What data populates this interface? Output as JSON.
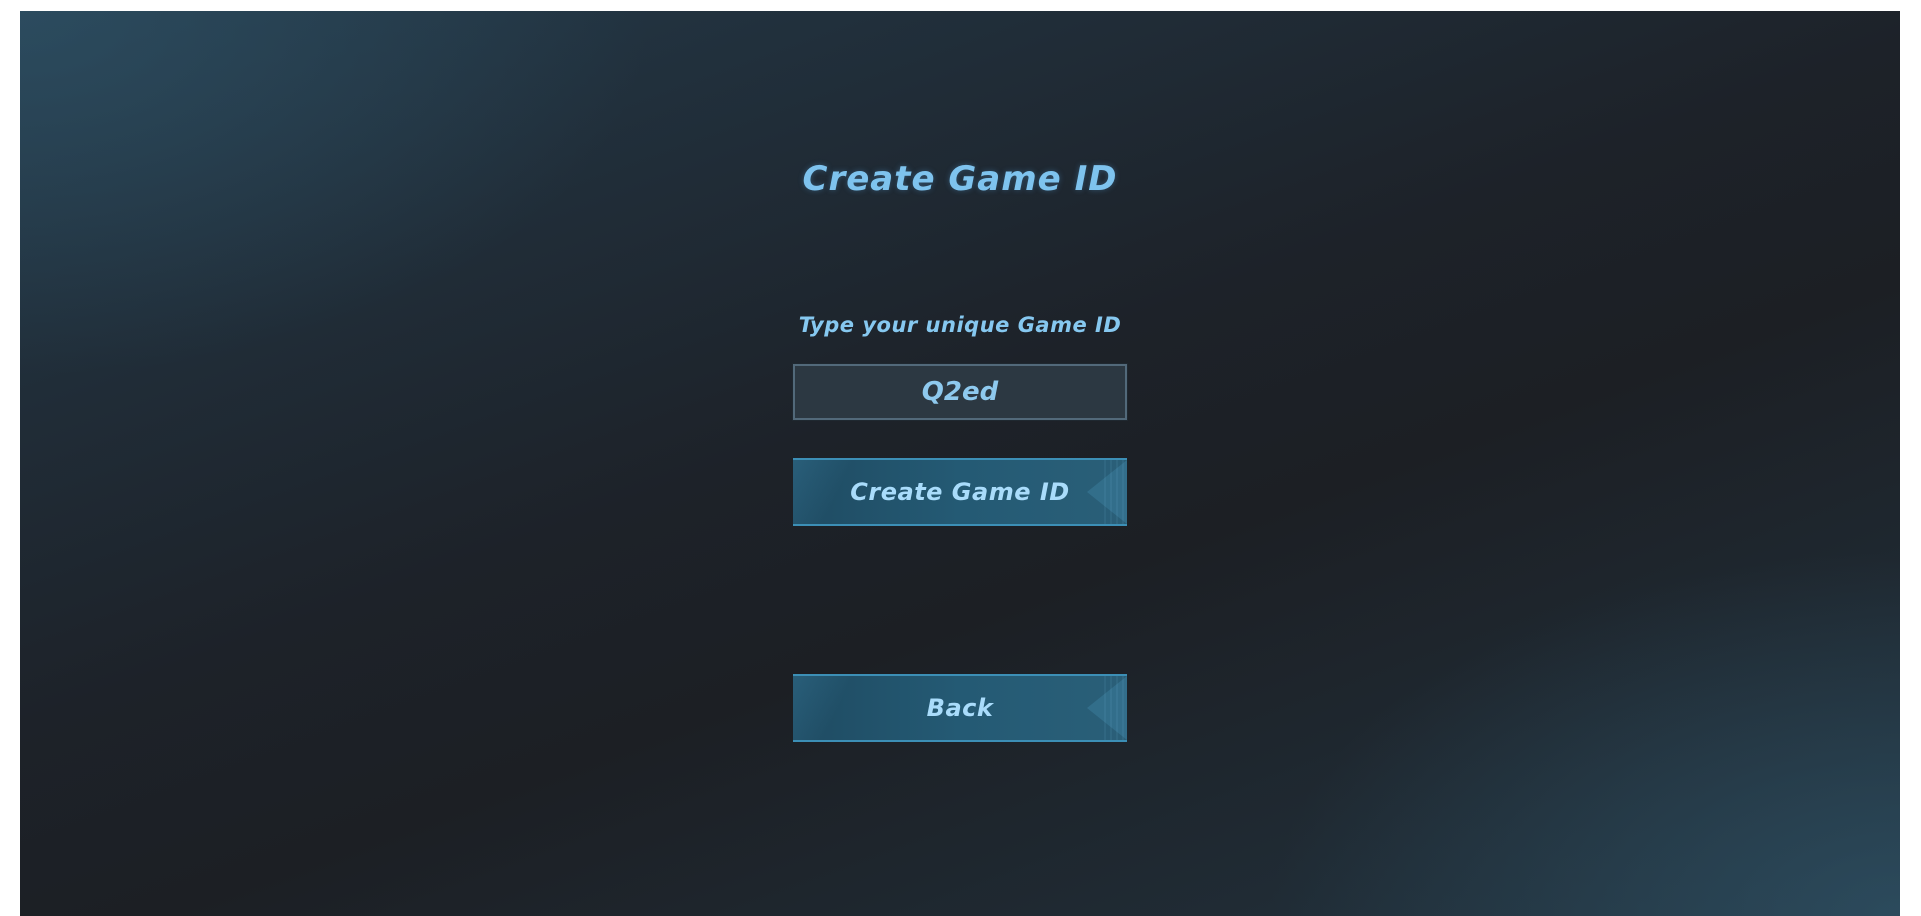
{
  "screen": {
    "title": "Create Game ID"
  },
  "form": {
    "prompt": "Type your unique Game ID",
    "game_id_value": "Q2ed"
  },
  "buttons": {
    "create_label": "Create Game ID",
    "back_label": "Back"
  },
  "colors": {
    "accent": "#7ec3ee",
    "button_fill": "#245a74",
    "button_border": "#3c8fb6",
    "background_dark": "#1c1f24"
  }
}
